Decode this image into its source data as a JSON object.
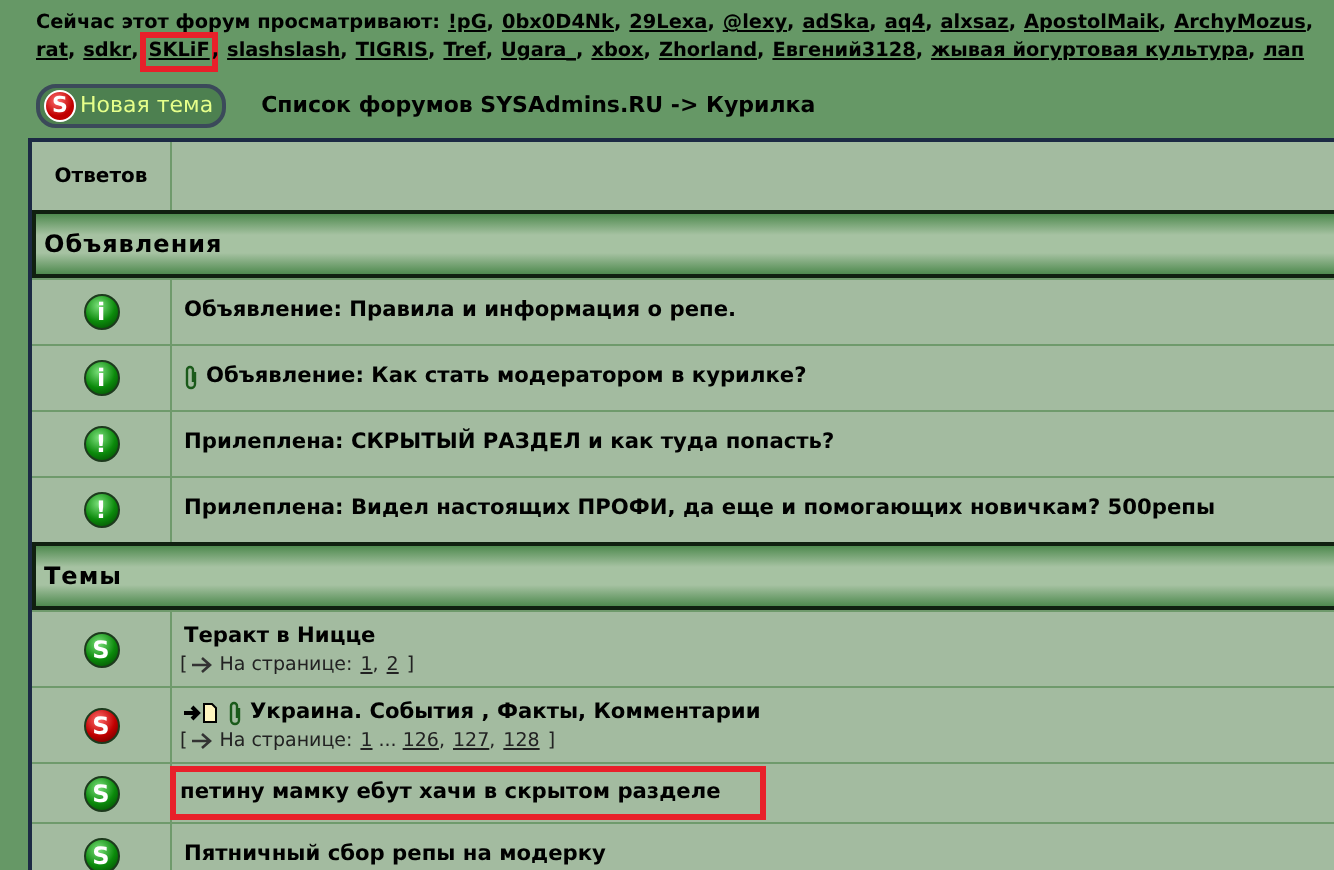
{
  "viewers": {
    "label": "Сейчас этот форум просматривают:",
    "separator": ",",
    "lines": [
      {
        "users": [
          {
            "name": "!pG",
            "highlighted": false
          },
          {
            "name": "0bx0D4Nk",
            "highlighted": false
          },
          {
            "name": "29Lexa",
            "highlighted": false
          },
          {
            "name": "@lexy",
            "highlighted": false
          },
          {
            "name": "adSka",
            "highlighted": false
          },
          {
            "name": "aq4",
            "highlighted": false
          },
          {
            "name": "alxsaz",
            "highlighted": false
          },
          {
            "name": "ApostolMaik",
            "highlighted": false
          },
          {
            "name": "ArchyMozus",
            "highlighted": false
          }
        ]
      },
      {
        "users": [
          {
            "name": "rat",
            "highlighted": false
          },
          {
            "name": "sdkr",
            "highlighted": false
          },
          {
            "name": "SKLiF",
            "highlighted": true
          },
          {
            "name": "slashslash",
            "highlighted": false
          },
          {
            "name": "TIGRIS",
            "highlighted": false
          },
          {
            "name": "Tref",
            "highlighted": false
          },
          {
            "name": "Ugara_",
            "highlighted": false
          },
          {
            "name": "xbox",
            "highlighted": false
          },
          {
            "name": "Zhorland",
            "highlighted": false
          },
          {
            "name": "Евгений3128",
            "highlighted": false
          },
          {
            "name": "жывая йогуртовая культура",
            "highlighted": false
          },
          {
            "name": "лап",
            "highlighted": false
          }
        ]
      }
    ]
  },
  "new_topic_button": {
    "icon_letter": "S",
    "label": "Новая тема"
  },
  "breadcrumb": "Список форумов SYSAdmins.RU -> Курилка",
  "table": {
    "columns": [
      "Ответов"
    ],
    "sections": [
      {
        "title": "Объявления",
        "rows": [
          {
            "kind": "announce",
            "icon_letter": "i",
            "title": "Объявление: Правила и информация о репе.",
            "attachment": false,
            "new_posts": false,
            "highlighted": false
          },
          {
            "kind": "announce",
            "icon_letter": "i",
            "title": "Объявление: Как стать модератором в курилке?",
            "attachment": true,
            "new_posts": false,
            "highlighted": false
          }
        ]
      },
      {
        "rows": [
          {
            "kind": "sticky",
            "icon_letter": "!",
            "title": "Прилеплена: СКРЫТЫЙ РАЗДЕЛ и как туда попасть?",
            "attachment": false,
            "new_posts": false,
            "highlighted": false
          },
          {
            "kind": "sticky",
            "icon_letter": "!",
            "title": "Прилеплена: Видел настоящих ПРОФИ, да еще и помогающих новичкам? 500репы",
            "attachment": false,
            "new_posts": false,
            "highlighted": false
          }
        ]
      },
      {
        "title": "Темы",
        "rows": [
          {
            "kind": "topic",
            "icon_letter": "S",
            "title": "Теракт в Ницце",
            "attachment": false,
            "new_posts": false,
            "highlighted": false,
            "pages": {
              "open": "[",
              "label": "На странице:",
              "separator": ",",
              "close": "]",
              "items": [
                {
                  "kind": "link",
                  "text": "1"
                },
                {
                  "kind": "link",
                  "text": "2"
                }
              ]
            }
          },
          {
            "kind": "hot",
            "icon_letter": "S",
            "title": "Украина. События , Факты, Комментарии",
            "attachment": true,
            "new_posts": true,
            "highlighted": false,
            "pages": {
              "open": "[",
              "label": "На странице:",
              "separator": ",",
              "close": "]",
              "items": [
                {
                  "kind": "link",
                  "text": "1"
                },
                {
                  "kind": "gap",
                  "text": "..."
                },
                {
                  "kind": "link",
                  "text": "126"
                },
                {
                  "kind": "link",
                  "text": "127"
                },
                {
                  "kind": "link",
                  "text": "128"
                }
              ]
            }
          },
          {
            "kind": "topic",
            "icon_letter": "S",
            "title": "петину мамку ебут хачи в скрытом разделе",
            "attachment": false,
            "new_posts": false,
            "highlighted": true
          },
          {
            "kind": "topic",
            "icon_letter": "S",
            "title": "Пятничный сбор репы на модерку",
            "attachment": false,
            "new_posts": false,
            "highlighted": false
          }
        ]
      }
    ]
  }
}
